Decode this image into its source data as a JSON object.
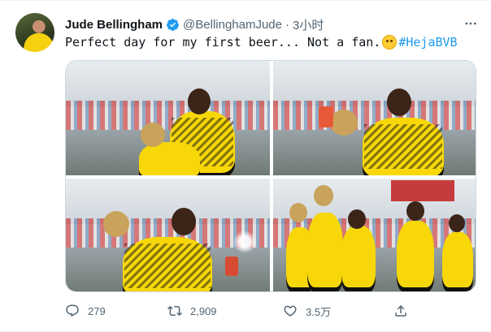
{
  "author": {
    "name": "Jude Bellingham",
    "handle": "@BellinghamJude",
    "separator": "·",
    "time": "3小时"
  },
  "tweet": {
    "text": "Perfect day for my first beer... Not a fan.",
    "emoji": "smiling-face-with-tear",
    "hashtag": "#HejaBVB"
  },
  "media": {
    "photo_count": 4
  },
  "actions": {
    "replies": "279",
    "retweets": "2,909",
    "likes": "3.5万"
  },
  "colors": {
    "link": "#1d9bf0",
    "secondary_text": "#536471",
    "verified": "#1d9bf0"
  },
  "icons": [
    "avatar",
    "verified-badge-icon",
    "more-icon",
    "reply-icon",
    "retweet-icon",
    "like-icon",
    "share-icon"
  ]
}
